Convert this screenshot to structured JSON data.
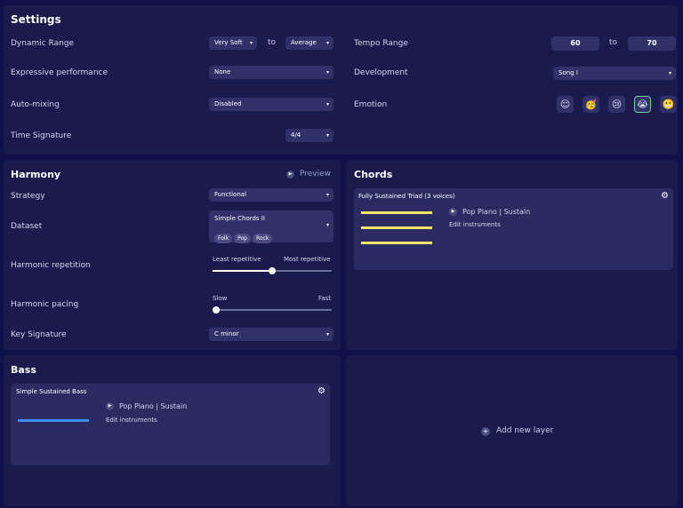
{
  "colors": {
    "background": "#10104a",
    "panel": "#1a1a4c",
    "control": "#2f3168",
    "chord_bar": "#f6e36a",
    "bass_bar": "#3b8ff0",
    "emotion_selected_border": "#6fd39a"
  },
  "settings": {
    "title": "Settings",
    "dynamic_range": {
      "label": "Dynamic Range",
      "from": "Very Soft",
      "to_word": "to",
      "to": "Average"
    },
    "expressive": {
      "label": "Expressive performance",
      "value": "None"
    },
    "auto_mixing": {
      "label": "Auto-mixing",
      "value": "Disabled"
    },
    "time_signature": {
      "label": "Time Signature",
      "value": "4/4"
    },
    "tempo_range": {
      "label": "Tempo Range",
      "from": "60",
      "to_word": "to",
      "to": "70"
    },
    "development": {
      "label": "Development",
      "value": "Song I"
    },
    "emotion": {
      "label": "Emotion",
      "options": [
        "content-face-icon",
        "party-face-icon",
        "sad-face-icon",
        "crying-face-icon",
        "grimace-face-icon"
      ],
      "glyphs": [
        "😌",
        "🥳",
        "😢",
        "😭",
        "😬"
      ],
      "selected_index": 3
    }
  },
  "harmony": {
    "title": "Harmony",
    "preview_label": "Preview",
    "strategy": {
      "label": "Strategy",
      "value": "Functional"
    },
    "dataset": {
      "label": "Dataset",
      "value": "Simple Chords II",
      "tags": [
        "Folk",
        "Pop",
        "Rock"
      ]
    },
    "repetition": {
      "label": "Harmonic repetition",
      "min_label": "Least repetitive",
      "max_label": "Most repetitive",
      "value": 0.5
    },
    "pacing": {
      "label": "Harmonic pacing",
      "min_label": "Slow",
      "max_label": "Fast",
      "value": 0.0
    },
    "key_signature": {
      "label": "Key Signature",
      "value": "C minor"
    }
  },
  "chords": {
    "title": "Chords",
    "card_title": "Fully Sustained Triad (3 voices)",
    "instrument": "Pop Piano | Sustain",
    "edit_label": "Edit instruments"
  },
  "bass": {
    "title": "Bass",
    "card_title": "Simple Sustained Bass",
    "instrument": "Pop Piano | Sustain",
    "edit_label": "Edit instruments"
  },
  "add_layer": {
    "label": "Add new layer"
  }
}
